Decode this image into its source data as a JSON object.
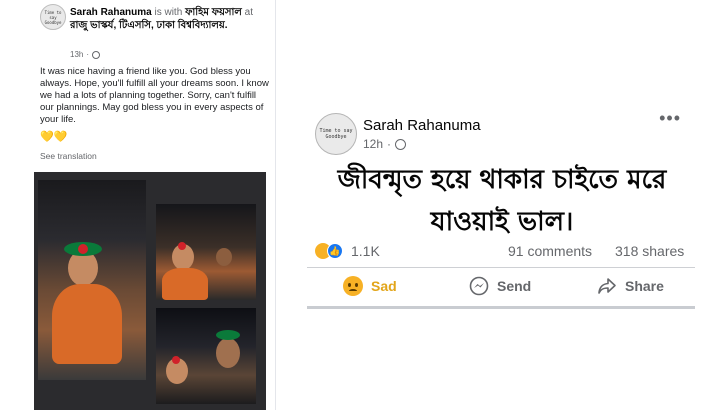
{
  "left_post": {
    "author": "Sarah Rahanuma",
    "with_text": "is with",
    "tagged": "ফাহিম ফয়সাল",
    "at_text": "at",
    "location": "রাজু ভাস্কর্য, টিএসসি, ঢাকা বিশ্ববিদ্যালয়.",
    "time": "13h",
    "body": "It was nice having a friend like you. God bless you always. Hope, you'll fulfill all your dreams soon. I know we had a lots of planning together. Sorry, can't fulfill our plannings. May god bless you in every aspects of your life.",
    "hearts": "💛💛",
    "see_translation": "See translation",
    "avatar_text": "Time to say Goodbye"
  },
  "right_post": {
    "author": "Sarah Rahanuma",
    "time": "12h",
    "more": "•••",
    "avatar_text": "Time to say Goodbye",
    "body_line1": "জীবন্মৃত হয়ে থাকার চাইতে মরে",
    "body_line2": "যাওয়াই ভাল।",
    "reaction_count": "1.1K",
    "comments": "91 comments",
    "shares": "318 shares",
    "actions": {
      "sad": "Sad",
      "send": "Send",
      "share": "Share"
    }
  },
  "colors": {
    "sad_accent": "#e2a51a",
    "like_blue": "#1877f2",
    "collage_bg": "#2b2b2e"
  }
}
